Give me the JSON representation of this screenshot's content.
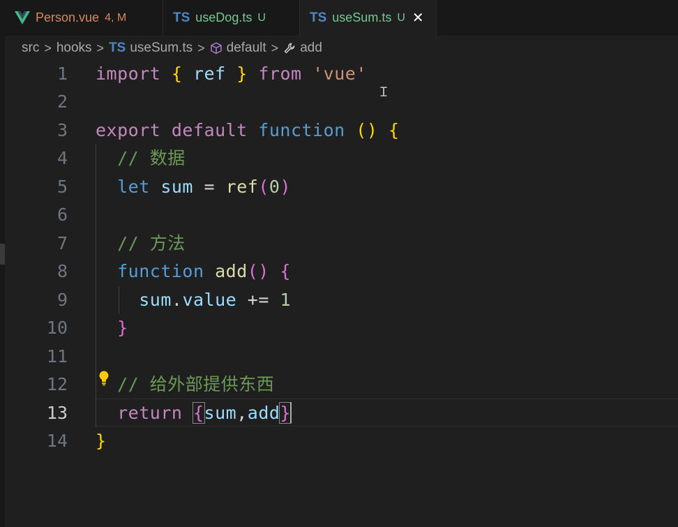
{
  "tabs": [
    {
      "icon": "vue-icon",
      "name": "Person.vue",
      "status": "4, M",
      "active": false,
      "name_color": "#d7875f",
      "status_color": "#d7875f"
    },
    {
      "icon": "typescript-icon",
      "icon_text": "TS",
      "name": "useDog.ts",
      "status": "U",
      "active": false,
      "name_color": "#73c991",
      "status_color": "#73c991"
    },
    {
      "icon": "typescript-icon",
      "icon_text": "TS",
      "name": "useSum.ts",
      "status": "U",
      "active": true,
      "name_color": "#73c991",
      "status_color": "#73c991",
      "close": "✕"
    }
  ],
  "breadcrumb": {
    "items": [
      "src",
      "hooks",
      "useSum.ts",
      "default",
      "add"
    ],
    "ts_badge": "TS",
    "separator": ">"
  },
  "editor": {
    "current_line": 13,
    "line_numbers": [
      "1",
      "2",
      "3",
      "4",
      "5",
      "6",
      "7",
      "8",
      "9",
      "10",
      "11",
      "12",
      "13",
      "14"
    ],
    "tokens": {
      "l1": {
        "import": "import",
        "ob": "{",
        "ref": "ref",
        "cb": "}",
        "from": "from",
        "vue": "'vue'"
      },
      "l3": {
        "export": "export",
        "default": "default",
        "function": "function",
        "parens": "()",
        "ob": "{"
      },
      "l4": {
        "comment": "// 数据"
      },
      "l5": {
        "let": "let",
        "sum": "sum",
        "eq": "=",
        "ref": "ref",
        "op": "(",
        "zero": "0",
        "cp": ")"
      },
      "l7": {
        "comment": "// 方法"
      },
      "l8": {
        "function": "function",
        "add": "add",
        "parens": "()",
        "ob": "{"
      },
      "l9": {
        "sum": "sum",
        "dot": ".",
        "value": "value",
        "op": "+=",
        "one": "1"
      },
      "l10": {
        "cb": "}"
      },
      "l12": {
        "comment": "// 给外部提供东西"
      },
      "l13": {
        "return": "return",
        "ob": "{",
        "sum": "sum",
        "comma": ",",
        "add": "add",
        "cb": "}"
      },
      "l14": {
        "cb": "}"
      }
    }
  },
  "colors": {
    "keyword": "#c586c0",
    "storage": "#569cd6",
    "variable": "#9cdcfe",
    "function": "#dcdcaa",
    "string": "#ce9178",
    "number": "#b5cea8",
    "comment": "#6a9955",
    "bracket1": "#ffd700",
    "bracket2": "#da70d6"
  }
}
